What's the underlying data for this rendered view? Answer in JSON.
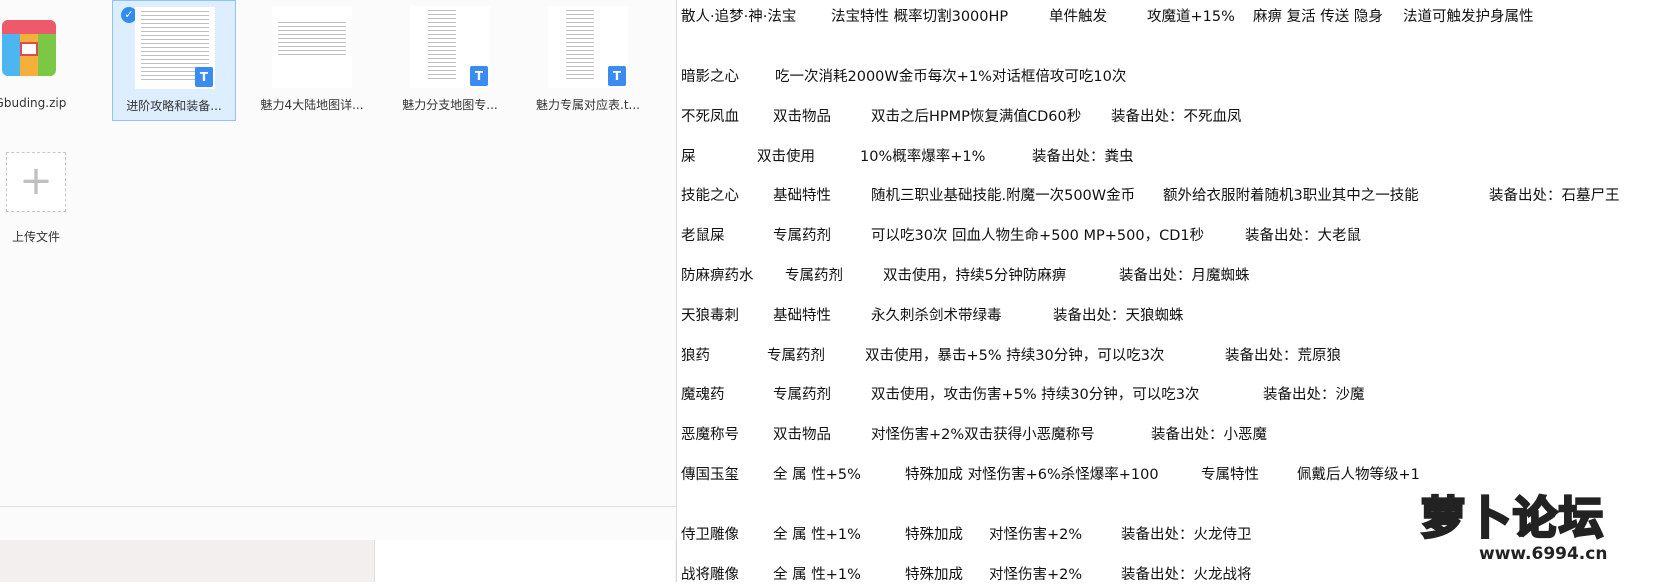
{
  "file_panel": {
    "files": [
      {
        "name": "FGbuding.zip",
        "type": "zip",
        "selected": false
      },
      {
        "name": "进阶攻略和装备...",
        "type": "doc",
        "selected": true
      },
      {
        "name": "魅力4大陆地图详...",
        "type": "doc",
        "selected": false
      },
      {
        "name": "魅力分支地图专...",
        "type": "doc",
        "selected": false
      },
      {
        "name": "魅力专属对应表.t...",
        "type": "doc",
        "selected": false
      }
    ],
    "doc_badge": "T",
    "check_mark": "✓",
    "upload_plus": "+",
    "upload_label": "上传文件"
  },
  "document": {
    "lines": [
      [
        "散人·追梦·神·法宝",
        "法宝特性 概率切割3000HP",
        "单件触发",
        "攻魔道+15%",
        "麻痹 复活 传送 隐身",
        "法道可触发护身属性"
      ],
      [
        "暗影之心",
        "吃一次消耗2000W金币每次+1%对话框倍攻可吃10次"
      ],
      [
        "不死凤血",
        "双击物品",
        "双击之后HPMP恢复满值",
        "CD60秒",
        "装备出处：不死血凤"
      ],
      [
        "屎",
        "双击使用",
        "10%概率爆率+1%",
        "装备出处：粪虫"
      ],
      [
        "技能之心",
        "基础特性",
        "随机三职业基础技能.附魔一次500W金币",
        "额外给衣服附着随机3职业其中之一技能",
        "装备出处：石墓尸王"
      ],
      [
        "老鼠屎",
        "专属药剂",
        "可以吃30次 回血人物生命+500 MP+500，CD1秒",
        "装备出处：大老鼠"
      ],
      [
        "防麻痹药水",
        "专属药剂",
        "双击使用，持续5分钟防麻痹",
        "装备出处：月魔蜘蛛"
      ],
      [
        "天狼毒刺",
        "基础特性",
        "永久刺杀剑术带绿毒",
        "装备出处：天狼蜘蛛"
      ],
      [
        "狼药",
        "专属药剂",
        "双击使用，暴击+5% 持续30分钟，可以吃3次",
        "装备出处：荒原狼"
      ],
      [
        "魔魂药",
        "专属药剂",
        "双击使用，攻击伤害+5% 持续30分钟，可以吃3次",
        "装备出处：沙魔"
      ],
      [
        "恶魔称号",
        "双击物品",
        "对怪伤害+2%双击获得小恶魔称号",
        "装备出处：小恶魔"
      ],
      [
        "傳国玉玺",
        "全 属 性+5%",
        "特殊加成 对怪伤害+6%杀怪爆率+100",
        "专属特性",
        "佩戴后人物等级+1"
      ],
      [
        "侍卫雕像",
        "全 属 性+1%",
        "特殊加成",
        "对怪伤害+2%",
        "装备出处：火龙侍卫"
      ],
      [
        "战将雕像",
        "全 属 性+1%",
        "特殊加成",
        "对怪伤害+2%",
        "装备出处：火龙战将"
      ]
    ]
  },
  "watermark": {
    "text": "萝卜论坛",
    "url": "www.6994.cn"
  }
}
